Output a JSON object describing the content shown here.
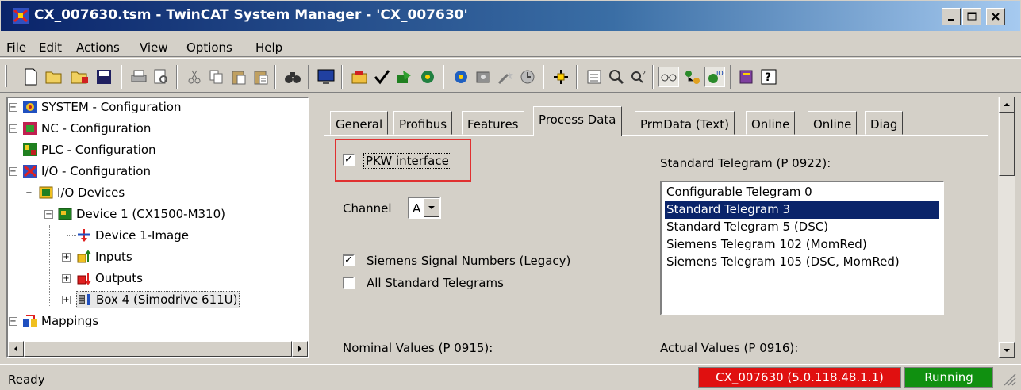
{
  "window": {
    "title": "CX_007630.tsm - TwinCAT System Manager - 'CX_007630'"
  },
  "menu": [
    "File",
    "Edit",
    "Actions",
    "View",
    "Options",
    "Help"
  ],
  "tree": {
    "items": [
      {
        "label": "SYSTEM - Configuration"
      },
      {
        "label": "NC - Configuration"
      },
      {
        "label": "PLC - Configuration"
      },
      {
        "label": "I/O - Configuration"
      },
      {
        "label": "I/O Devices"
      },
      {
        "label": "Device 1 (CX1500-M310)"
      },
      {
        "label": "Device 1-Image"
      },
      {
        "label": "Inputs"
      },
      {
        "label": "Outputs"
      },
      {
        "label": "Box 4 (Simodrive 611U)"
      },
      {
        "label": "Mappings"
      }
    ]
  },
  "tabs": [
    "General",
    "Profibus",
    "Features",
    "Process Data",
    "PrmData (Text)",
    "Online",
    "Online",
    "Diag"
  ],
  "active_tab": "Process Data",
  "process_data": {
    "pkw_label": "PKW interface",
    "pkw_checked": true,
    "channel_label": "Channel",
    "channel_value": "A",
    "siemens_label": "Siemens Signal Numbers (Legacy)",
    "siemens_checked": true,
    "all_std_label": "All Standard Telegrams",
    "all_std_checked": false,
    "std_telegram_label": "Standard Telegram (P 0922):",
    "telegrams": [
      "Configurable Telegram 0",
      "Standard Telegram 3",
      "Standard Telegram 5 (DSC)",
      "Siemens Telegram 102 (MomRed)",
      "Siemens Telegram 105 (DSC, MomRed)"
    ],
    "selected_telegram": "Standard Telegram 3",
    "nominal_label": "Nominal Values (P 0915):",
    "actual_label": "Actual Values (P 0916):"
  },
  "status": {
    "text": "Ready",
    "target": "CX_007630 (5.0.118.48.1.1)",
    "state": "Running",
    "colors": {
      "target_bg": "#e01010",
      "state_bg": "#109010",
      "title_bg": "#0a246a",
      "selection": "#0a246a"
    }
  }
}
